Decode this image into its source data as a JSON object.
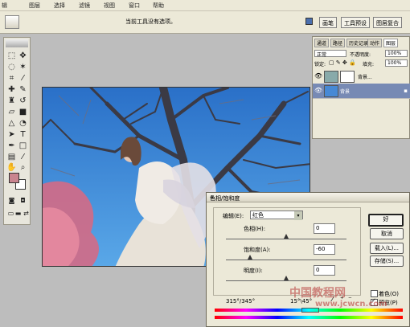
{
  "menu": [
    "图层",
    "选择",
    "滤镜",
    "视图",
    "窗口",
    "帮助"
  ],
  "menu_partial_first": "辑",
  "options_hint": "当前工具没有选项。",
  "palette_wells": [
    "画笔",
    "工具预设",
    "图层复合"
  ],
  "layers_panel": {
    "tabs": [
      "通道",
      "路径",
      "历史记录",
      "动作",
      "图层"
    ],
    "blend_mode": "正常",
    "opacity_label": "不透明度:",
    "opacity_value": "100%",
    "lock_label": "锁定:",
    "fill_label": "填充:",
    "fill_value": "100%",
    "layers": [
      {
        "name": "背景...",
        "selected": false
      },
      {
        "name": "背景",
        "selected": true
      }
    ]
  },
  "dialog": {
    "title": "色相/饱和度",
    "edit_label": "编辑(E):",
    "edit_value": "红色",
    "hue_label": "色相(H):",
    "hue_value": "0",
    "saturation_label": "饱和度(A):",
    "saturation_value": "-60",
    "lightness_label": "明度(I):",
    "lightness_value": "0",
    "range_left": "315°/345°",
    "range_right": "15°\\45°",
    "buttons": [
      "好",
      "取消",
      "载入(L)...",
      "存储(S)..."
    ],
    "colorize_label": "着色(O)",
    "preview_label": "预览(P)",
    "hue_pos": 0.5,
    "saturation_pos": 0.2,
    "lightness_pos": 0.5
  },
  "watermark": "中国教程网",
  "watermark_url": "www.jcwcn.com"
}
